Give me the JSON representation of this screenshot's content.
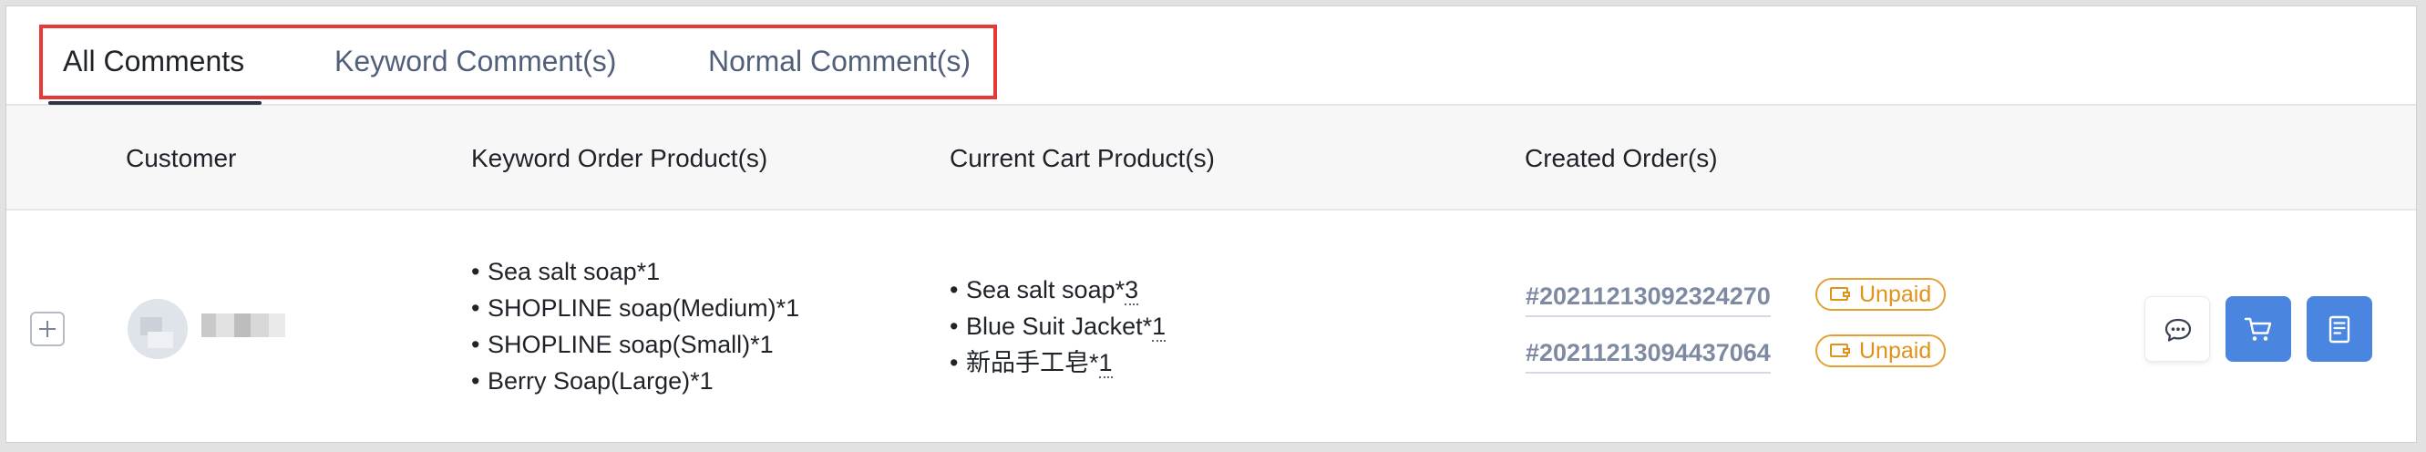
{
  "tabs": [
    {
      "label": "All Comments",
      "active": true
    },
    {
      "label": "Keyword Comment(s)",
      "active": false
    },
    {
      "label": "Normal Comment(s)",
      "active": false
    }
  ],
  "columns": {
    "customer": "Customer",
    "keyword_products": "Keyword Order Product(s)",
    "cart_products": "Current Cart Product(s)",
    "orders": "Created Order(s)"
  },
  "row": {
    "keyword_products": [
      {
        "bullet": "•",
        "text": "Sea salt soap*1"
      },
      {
        "bullet": "•",
        "text": "SHOPLINE soap(Medium)*1"
      },
      {
        "bullet": "•",
        "text": "SHOPLINE soap(Small)*1"
      },
      {
        "bullet": "•",
        "text": "Berry Soap(Large)*1"
      }
    ],
    "cart_products": [
      {
        "bullet": "•",
        "name": "Sea salt soap*",
        "qty": "3"
      },
      {
        "bullet": "•",
        "name": "Blue Suit Jacket*",
        "qty": "1"
      },
      {
        "bullet": "•",
        "name": "新品手工皂*",
        "qty": "1"
      }
    ],
    "orders": [
      {
        "number": "#20211213092324270",
        "status": "Unpaid"
      },
      {
        "number": "#20211213094437064",
        "status": "Unpaid"
      }
    ]
  },
  "icons": {
    "expand": "plus-icon",
    "comment": "chat-bubble-icon",
    "cart": "cart-icon",
    "order": "clipboard-icon"
  },
  "colors": {
    "accent": "#4a86e0",
    "status_unpaid": "#e0921b",
    "highlight": "#e53935"
  }
}
